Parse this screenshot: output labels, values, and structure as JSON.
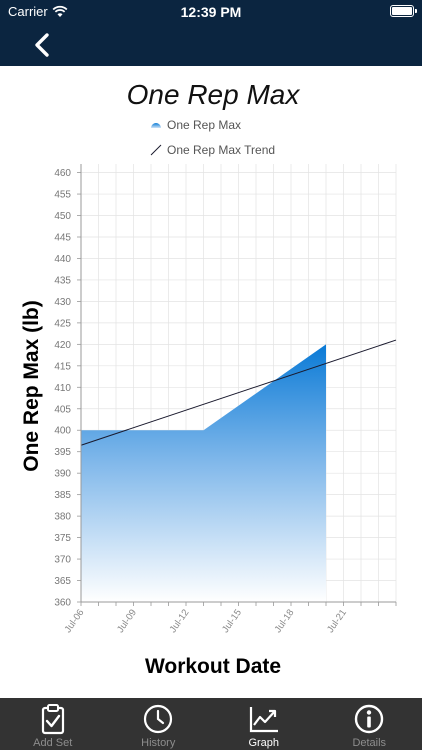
{
  "status": {
    "carrier": "Carrier",
    "time": "12:39 PM"
  },
  "nav": {
    "back_icon": "chevron-left-icon"
  },
  "chart_data": {
    "type": "area",
    "title": "One Rep Max",
    "xlabel": "Workout Date",
    "ylabel": "One Rep Max (lb)",
    "legend": [
      "One Rep Max",
      "One Rep Max Trend"
    ],
    "x_ticks": [
      "Jul-06",
      "Jul-09",
      "Jul-12",
      "Jul-15",
      "Jul-18",
      "Jul-21"
    ],
    "x_tick_days": [
      6,
      9,
      12,
      15,
      18,
      21
    ],
    "xlim": [
      "Jul-06",
      "Jul-24"
    ],
    "ylim": [
      360,
      462
    ],
    "y_ticks": [
      360,
      365,
      370,
      375,
      380,
      385,
      390,
      395,
      400,
      405,
      410,
      415,
      420,
      425,
      430,
      435,
      440,
      445,
      450,
      455,
      460
    ],
    "grid": true,
    "series": [
      {
        "name": "One Rep Max",
        "points": [
          [
            "Jul-06",
            400
          ],
          [
            "Jul-13",
            400
          ],
          [
            "Jul-20",
            420
          ]
        ]
      },
      {
        "name": "One Rep Max Trend",
        "points": [
          [
            "Jul-06",
            396.5
          ],
          [
            "Jul-24",
            421
          ]
        ]
      }
    ],
    "colors": {
      "area_top": "#0a7ad6",
      "area_bottom": "#ffffff",
      "trend": "#1a1a2e",
      "grid": "#e3e3e3"
    }
  },
  "tabs": [
    {
      "label": "Add Set",
      "icon": "clipboard-check-icon",
      "active": false
    },
    {
      "label": "History",
      "icon": "clock-icon",
      "active": false
    },
    {
      "label": "Graph",
      "icon": "line-chart-icon",
      "active": true
    },
    {
      "label": "Details",
      "icon": "info-icon",
      "active": false
    }
  ]
}
